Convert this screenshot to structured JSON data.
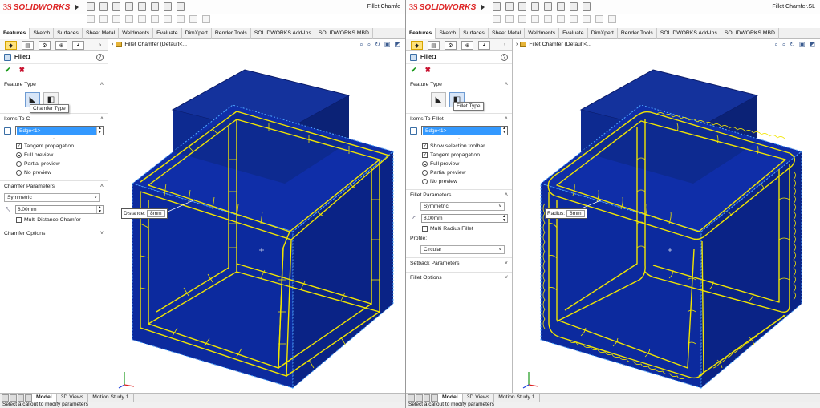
{
  "app": {
    "brand_ds": "3S",
    "brand_name": "SOLIDWORKS",
    "status_text": "Select a callout to modify parameters"
  },
  "left": {
    "doc_title": "Fillet Chamfe",
    "tabs": [
      "Features",
      "Sketch",
      "Surfaces",
      "Sheet Metal",
      "Weldments",
      "Evaluate",
      "DimXpert",
      "Render Tools",
      "SOLIDWORKS Add-Ins",
      "SOLIDWORKS MBD"
    ],
    "feature_name": "Fillet1",
    "tree_label": "Fillet Chamfer  (Default<...",
    "feature_type_label": "Feature Type",
    "tooltip": "Chamfer Type",
    "items_label": "Items To C",
    "selection": "Edge<1>",
    "options": [
      {
        "label": "Tangent propagation",
        "kind": "check",
        "on": true
      },
      {
        "label": "Full preview",
        "kind": "radio",
        "on": true
      },
      {
        "label": "Partial preview",
        "kind": "radio",
        "on": false
      },
      {
        "label": "No preview",
        "kind": "radio",
        "on": false
      }
    ],
    "params_label": "Chamfer Parameters",
    "param_type": "Symmetric",
    "value": "8.00mm",
    "multi_label": "Multi Distance Chamfer",
    "options_label": "Chamfer Options",
    "callout_label": "Distance:",
    "callout_value": "8mm",
    "bottom_tabs": [
      "Model",
      "3D Views",
      "Motion Study 1"
    ]
  },
  "right": {
    "doc_title": "Fillet Chamfer.SL",
    "tabs": [
      "Features",
      "Sketch",
      "Surfaces",
      "Sheet Metal",
      "Weldments",
      "Evaluate",
      "DimXpert",
      "Render Tools",
      "SOLIDWORKS Add-Ins",
      "SOLIDWORKS MBD"
    ],
    "feature_name": "Fillet1",
    "tree_label": "Fillet Chamfer  (Default<...",
    "feature_type_label": "Feature Type",
    "tooltip": "Fillet Type",
    "items_label": "Items To Fillet",
    "selection": "Edge<1>",
    "options": [
      {
        "label": "Show selection toolbar",
        "kind": "check",
        "on": true
      },
      {
        "label": "Tangent propagation",
        "kind": "check",
        "on": true
      },
      {
        "label": "Full preview",
        "kind": "radio",
        "on": true
      },
      {
        "label": "Partial preview",
        "kind": "radio",
        "on": false
      },
      {
        "label": "No preview",
        "kind": "radio",
        "on": false
      }
    ],
    "params_label": "Fillet Parameters",
    "param_type": "Symmetric",
    "value": "8.00mm",
    "multi_label": "Multi Radius Fillet",
    "profile_label": "Profile:",
    "profile_value": "Circular",
    "setback_label": "Setback Parameters",
    "options_label": "Fillet Options",
    "callout_label": "Radius:",
    "callout_value": "8mm",
    "bottom_tabs": [
      "Model",
      "3D Views",
      "Motion Study 1"
    ]
  },
  "icons": {
    "ok": "check-icon",
    "cancel": "close-icon",
    "help": "help-icon"
  },
  "colors": {
    "model_blue": "#0c2a9e",
    "preview_yellow": "#f2e600",
    "brand_red": "#d22222",
    "selection_blue": "#3399ff"
  }
}
